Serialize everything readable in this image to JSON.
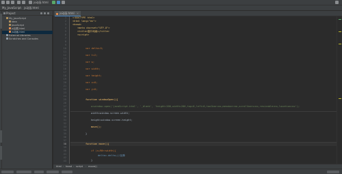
{
  "toolbar": {
    "icons": [
      "open-folder-icon",
      "save-icon",
      "sync-icon",
      "back-icon",
      "forward-icon",
      "run-config-icon",
      "run-icon",
      "debug-icon",
      "stop-icon",
      "search-icon"
    ],
    "run_config": "js动画.html",
    "accent_run": "#59a869",
    "accent_debug": "#4a88c7"
  },
  "navbar": {
    "project": "My_JavaScript",
    "file": "js动画.html"
  },
  "project_panel": {
    "title": "Project",
    "tree": [
      {
        "label": "My_JavaScript",
        "kind": "folder",
        "indent": 1
      },
      {
        "label": "idea",
        "kind": "folder",
        "indent": 2
      },
      {
        "label": "JavaScript",
        "kind": "folder",
        "indent": 2
      },
      {
        "label": "js加载.html",
        "kind": "html",
        "indent": 2
      },
      {
        "label": "js动画.html",
        "kind": "html",
        "indent": 2,
        "selected": true
      },
      {
        "label": "External Libraries",
        "kind": "lib",
        "indent": 1
      },
      {
        "label": "Scratches and Consoles",
        "kind": "lib",
        "indent": 1
      }
    ]
  },
  "editor": {
    "tab_label": "js动画.html",
    "line_numbers": [
      "1",
      "2",
      "3",
      "4",
      "5",
      "6",
      "7",
      "8",
      "9",
      "10",
      "11",
      "12",
      "13",
      "14",
      "15",
      "16",
      "17",
      "18",
      "19",
      "20",
      "21",
      "22",
      "23",
      "24",
      "25",
      "26",
      "27",
      "28",
      "29",
      "30",
      "31",
      "32",
      "33",
      "34",
      "35",
      "36",
      "37",
      "38",
      "39",
      "40",
      "41",
      "42",
      "43"
    ],
    "highlighted_line": 38
  },
  "code_text": {
    "l1_doctype": "<!DOCTYPE html>",
    "l2_html": "<html lang=\"en\">",
    "l3_head": "<head>",
    "l4_meta": "<meta charset=\"UTF-8\">",
    "l5_title": "<title>窗口动画</title>",
    "l6_script": "<script>",
    "v_delta": "var delta=5;",
    "v_t": "var t=2;",
    "v_w": "var w;",
    "v_width": "var width;",
    "v_height": "var height;",
    "v_x": "var x=0;",
    "v_y": "var y=0;",
    "fn_open": "function windowOpen(){",
    "open_call": "w=window.open('javaScript.html', '_blank', 'height=200,width=200,top=0,left=0,toolbar=no,menubar=no,scrollbars=no,resizable=no,location=no');",
    "width_assign": "width=window.screen.width;",
    "height_assign": "height=window.screen.height;",
    "move_call": "move();",
    "close_brace": "}",
    "fn_move": "function move(){",
    "if_x": "if (x+90>=width){",
    "delta_neg": "delta=-delta;//反弹",
    "close_brace2": "}",
    "x_plus": "x+=delta;",
    "if_y": "if (y+90>=height){",
    "t_neg": "t=-t;//反弹"
  },
  "breadcrumbs": [
    "html",
    "head",
    "script",
    "move()"
  ],
  "status": {
    "blocks": 6
  }
}
